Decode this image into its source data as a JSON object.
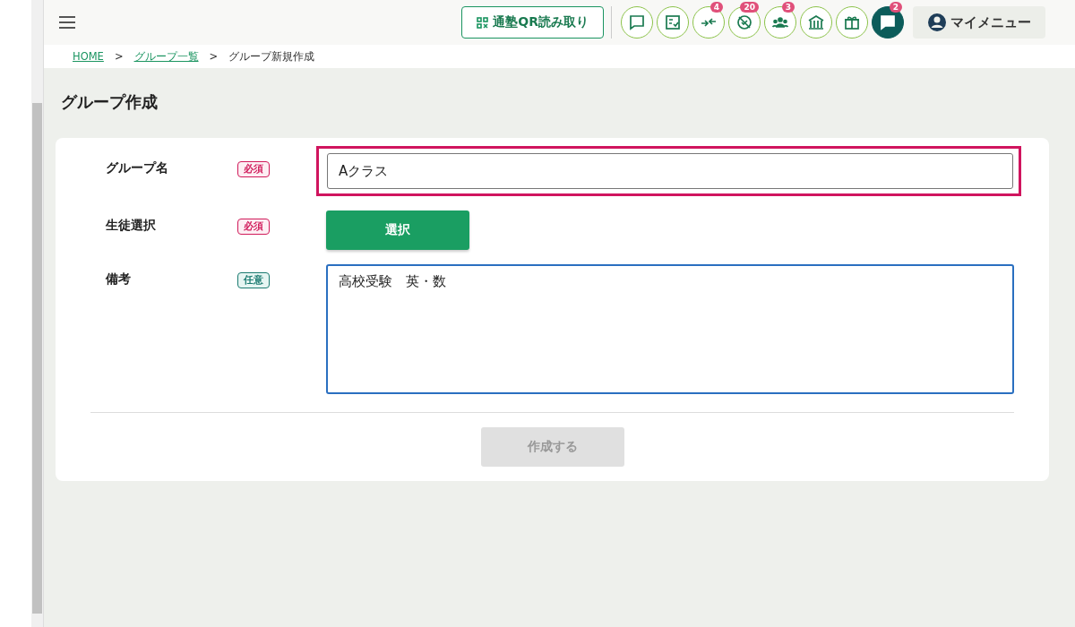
{
  "header": {
    "qr_button": "通塾QR読み取り",
    "icons": [
      {
        "kind": "message",
        "active": false
      },
      {
        "kind": "checklist",
        "active": false
      },
      {
        "kind": "arrows",
        "badge": "4",
        "active": false
      },
      {
        "kind": "blocked",
        "badge": "20",
        "active": false
      },
      {
        "kind": "group",
        "badge": "3",
        "active": false
      },
      {
        "kind": "school",
        "active": false
      },
      {
        "kind": "gift",
        "active": false
      },
      {
        "kind": "chat",
        "badge": "2",
        "active": true
      }
    ],
    "my_menu": "マイメニュー"
  },
  "breadcrumb": [
    {
      "label": "HOME",
      "link": true
    },
    {
      "label": ">",
      "link": false
    },
    {
      "label": "グループ一覧",
      "link": true
    },
    {
      "label": ">",
      "link": false
    },
    {
      "label": "グループ新規作成",
      "link": false
    }
  ],
  "page_title": "グループ作成",
  "form": {
    "rows": [
      {
        "kind": "input",
        "label": "グループ名",
        "tag": "必須",
        "required": true,
        "value": "Aクラス",
        "highlighted": true
      },
      {
        "kind": "button",
        "label": "生徒選択",
        "tag": "必須",
        "required": true,
        "button": "選択"
      },
      {
        "kind": "textarea",
        "label": "備考",
        "tag": "任意",
        "required": false,
        "value": "高校受験　英・数",
        "focused": true
      }
    ],
    "submit": {
      "label": "作成する",
      "disabled": true
    }
  }
}
